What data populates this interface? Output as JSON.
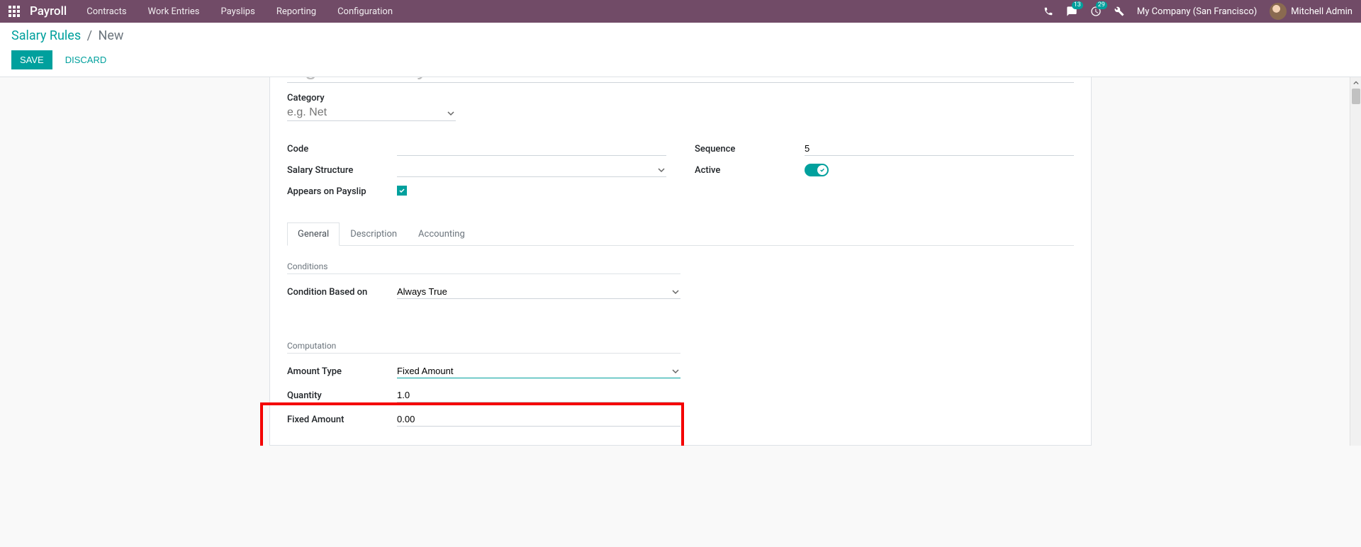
{
  "navbar": {
    "brand": "Payroll",
    "menu": [
      "Contracts",
      "Work Entries",
      "Payslips",
      "Reporting",
      "Configuration"
    ],
    "messages_badge": "13",
    "activities_badge": "29",
    "company": "My Company (San Francisco)",
    "user": "Mitchell Admin"
  },
  "breadcrumb": {
    "parent": "Salary Rules",
    "current": "New"
  },
  "buttons": {
    "save": "SAVE",
    "discard": "DISCARD"
  },
  "form": {
    "name_placeholder": "e.g. Net Salary",
    "category_label": "Category",
    "category_placeholder": "e.g. Net",
    "labels": {
      "code": "Code",
      "salary_structure": "Salary Structure",
      "appears_on_payslip": "Appears on Payslip",
      "sequence": "Sequence",
      "active": "Active"
    },
    "values": {
      "code": "",
      "salary_structure": "",
      "appears_on_payslip": true,
      "sequence": "5",
      "active": true
    },
    "tabs": [
      "General",
      "Description",
      "Accounting"
    ],
    "active_tab": 0,
    "conditions": {
      "section": "Conditions",
      "condition_label": "Condition Based on",
      "condition_value": "Always True"
    },
    "computation": {
      "section": "Computation",
      "amount_type_label": "Amount Type",
      "amount_type_value": "Fixed Amount",
      "quantity_label": "Quantity",
      "quantity_value": "1.0",
      "fixed_amount_label": "Fixed Amount",
      "fixed_amount_value": "0.00"
    }
  }
}
